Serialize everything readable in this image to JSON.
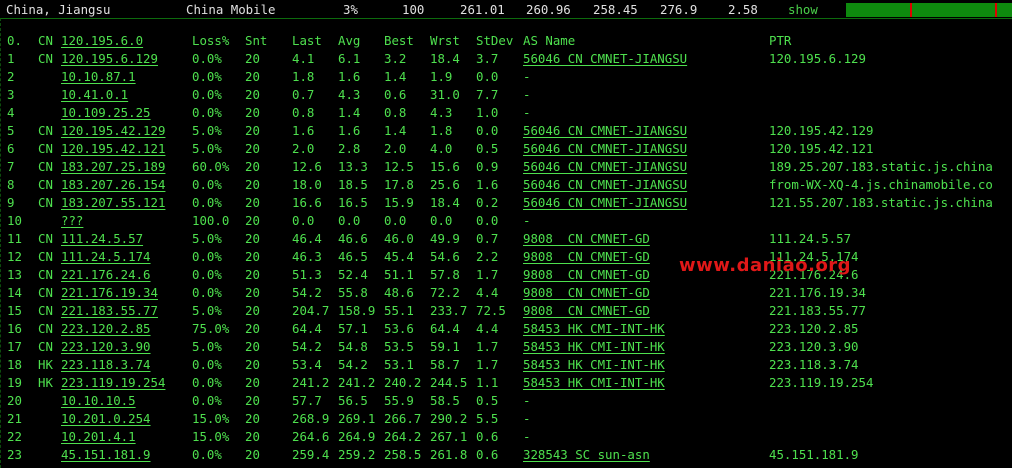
{
  "topbar": {
    "location": "China, Jiangsu",
    "isp": "China Mobile",
    "loss": "3%",
    "sent": "100",
    "last": "261.01",
    "avg": "260.96",
    "best": "258.45",
    "worst": "276.9",
    "stdev": "2.58",
    "show_label": "show"
  },
  "headers": {
    "num": "0.",
    "cc": "CN",
    "host": "120.195.6.0",
    "loss": "Loss%",
    "snt": "Snt",
    "last": "Last",
    "avg": "Avg",
    "best": "Best",
    "wrst": "Wrst",
    "stdev": "StDev",
    "asname": "AS Name",
    "ptr": "PTR"
  },
  "hops": [
    {
      "num": "1",
      "cc": "CN",
      "host": "120.195.6.129",
      "loss": "0.0%",
      "snt": "20",
      "last": "4.1",
      "avg": "6.1",
      "best": "3.2",
      "wrst": "18.4",
      "stdev": "3.7",
      "asname": "56046 CN CMNET-JIANGSU",
      "ptr": "120.195.6.129"
    },
    {
      "num": "2",
      "cc": "",
      "host": "10.10.87.1",
      "loss": "0.0%",
      "snt": "20",
      "last": "1.8",
      "avg": "1.6",
      "best": "1.4",
      "wrst": "1.9",
      "stdev": "0.0",
      "asname": "-",
      "ptr": ""
    },
    {
      "num": "3",
      "cc": "",
      "host": "10.41.0.1",
      "loss": "0.0%",
      "snt": "20",
      "last": "0.7",
      "avg": "4.3",
      "best": "0.6",
      "wrst": "31.0",
      "stdev": "7.7",
      "asname": "-",
      "ptr": ""
    },
    {
      "num": "4",
      "cc": "",
      "host": "10.109.25.25",
      "loss": "0.0%",
      "snt": "20",
      "last": "0.8",
      "avg": "1.4",
      "best": "0.8",
      "wrst": "4.3",
      "stdev": "1.0",
      "asname": "-",
      "ptr": ""
    },
    {
      "num": "5",
      "cc": "CN",
      "host": "120.195.42.129",
      "loss": "5.0%",
      "snt": "20",
      "last": "1.6",
      "avg": "1.6",
      "best": "1.4",
      "wrst": "1.8",
      "stdev": "0.0",
      "asname": "56046 CN CMNET-JIANGSU",
      "ptr": "120.195.42.129"
    },
    {
      "num": "6",
      "cc": "CN",
      "host": "120.195.42.121",
      "loss": "5.0%",
      "snt": "20",
      "last": "2.0",
      "avg": "2.8",
      "best": "2.0",
      "wrst": "4.0",
      "stdev": "0.5",
      "asname": "56046 CN CMNET-JIANGSU",
      "ptr": "120.195.42.121"
    },
    {
      "num": "7",
      "cc": "CN",
      "host": "183.207.25.189",
      "loss": "60.0%",
      "snt": "20",
      "last": "12.6",
      "avg": "13.3",
      "best": "12.5",
      "wrst": "15.6",
      "stdev": "0.9",
      "asname": "56046 CN CMNET-JIANGSU",
      "ptr": "189.25.207.183.static.js.china"
    },
    {
      "num": "8",
      "cc": "CN",
      "host": "183.207.26.154",
      "loss": "0.0%",
      "snt": "20",
      "last": "18.0",
      "avg": "18.5",
      "best": "17.8",
      "wrst": "25.6",
      "stdev": "1.6",
      "asname": "56046 CN CMNET-JIANGSU",
      "ptr": "from-WX-XQ-4.js.chinamobile.co"
    },
    {
      "num": "9",
      "cc": "CN",
      "host": "183.207.55.121",
      "loss": "0.0%",
      "snt": "20",
      "last": "16.6",
      "avg": "16.5",
      "best": "15.9",
      "wrst": "18.4",
      "stdev": "0.2",
      "asname": "56046 CN CMNET-JIANGSU",
      "ptr": "121.55.207.183.static.js.china"
    },
    {
      "num": "10",
      "cc": "",
      "host": "???",
      "loss": "100.0",
      "snt": "20",
      "last": "0.0",
      "avg": "0.0",
      "best": "0.0",
      "wrst": "0.0",
      "stdev": "0.0",
      "asname": "-",
      "ptr": ""
    },
    {
      "num": "11",
      "cc": "CN",
      "host": "111.24.5.57",
      "loss": "5.0%",
      "snt": "20",
      "last": "46.4",
      "avg": "46.6",
      "best": "46.0",
      "wrst": "49.9",
      "stdev": "0.7",
      "asname": "9808  CN CMNET-GD",
      "ptr": "111.24.5.57"
    },
    {
      "num": "12",
      "cc": "CN",
      "host": "111.24.5.174",
      "loss": "0.0%",
      "snt": "20",
      "last": "46.3",
      "avg": "46.5",
      "best": "45.4",
      "wrst": "54.6",
      "stdev": "2.2",
      "asname": "9808  CN CMNET-GD",
      "ptr": "111.24.5.174"
    },
    {
      "num": "13",
      "cc": "CN",
      "host": "221.176.24.6",
      "loss": "0.0%",
      "snt": "20",
      "last": "51.3",
      "avg": "52.4",
      "best": "51.1",
      "wrst": "57.8",
      "stdev": "1.7",
      "asname": "9808  CN CMNET-GD",
      "ptr": "221.176.24.6"
    },
    {
      "num": "14",
      "cc": "CN",
      "host": "221.176.19.34",
      "loss": "0.0%",
      "snt": "20",
      "last": "54.2",
      "avg": "55.8",
      "best": "48.6",
      "wrst": "72.2",
      "stdev": "4.4",
      "asname": "9808  CN CMNET-GD",
      "ptr": "221.176.19.34"
    },
    {
      "num": "15",
      "cc": "CN",
      "host": "221.183.55.77",
      "loss": "5.0%",
      "snt": "20",
      "last": "204.7",
      "avg": "158.9",
      "best": "55.1",
      "wrst": "233.7",
      "stdev": "72.5",
      "asname": "9808  CN CMNET-GD",
      "ptr": "221.183.55.77"
    },
    {
      "num": "16",
      "cc": "CN",
      "host": "223.120.2.85",
      "loss": "75.0%",
      "snt": "20",
      "last": "64.4",
      "avg": "57.1",
      "best": "53.6",
      "wrst": "64.4",
      "stdev": "4.4",
      "asname": "58453 HK CMI-INT-HK",
      "ptr": "223.120.2.85"
    },
    {
      "num": "17",
      "cc": "CN",
      "host": "223.120.3.90",
      "loss": "5.0%",
      "snt": "20",
      "last": "54.2",
      "avg": "54.8",
      "best": "53.5",
      "wrst": "59.1",
      "stdev": "1.7",
      "asname": "58453 HK CMI-INT-HK",
      "ptr": "223.120.3.90"
    },
    {
      "num": "18",
      "cc": "HK",
      "host": "223.118.3.74",
      "loss": "0.0%",
      "snt": "20",
      "last": "53.4",
      "avg": "54.2",
      "best": "53.1",
      "wrst": "58.7",
      "stdev": "1.7",
      "asname": "58453 HK CMI-INT-HK",
      "ptr": "223.118.3.74"
    },
    {
      "num": "19",
      "cc": "HK",
      "host": "223.119.19.254",
      "loss": "0.0%",
      "snt": "20",
      "last": "241.2",
      "avg": "241.2",
      "best": "240.2",
      "wrst": "244.5",
      "stdev": "1.1",
      "asname": "58453 HK CMI-INT-HK",
      "ptr": "223.119.19.254"
    },
    {
      "num": "20",
      "cc": "",
      "host": "10.10.10.5",
      "loss": "0.0%",
      "snt": "20",
      "last": "57.7",
      "avg": "56.5",
      "best": "55.9",
      "wrst": "58.5",
      "stdev": "0.5",
      "asname": "-",
      "ptr": ""
    },
    {
      "num": "21",
      "cc": "",
      "host": "10.201.0.254",
      "loss": "15.0%",
      "snt": "20",
      "last": "268.9",
      "avg": "269.1",
      "best": "266.7",
      "wrst": "290.2",
      "stdev": "5.5",
      "asname": "-",
      "ptr": ""
    },
    {
      "num": "22",
      "cc": "",
      "host": "10.201.4.1",
      "loss": "15.0%",
      "snt": "20",
      "last": "264.6",
      "avg": "264.9",
      "best": "264.2",
      "wrst": "267.1",
      "stdev": "0.6",
      "asname": "-",
      "ptr": ""
    },
    {
      "num": "23",
      "cc": "",
      "host": "45.151.181.9",
      "loss": "0.0%",
      "snt": "20",
      "last": "259.4",
      "avg": "259.2",
      "best": "258.5",
      "wrst": "261.8",
      "stdev": "0.6",
      "asname": "328543 SC sun-asn",
      "ptr": "45.151.181.9"
    }
  ],
  "watermark": "www.daniao.org",
  "colors": {
    "background": "#000000",
    "text": "#4ee04e",
    "topbar_text": "#e0e0e0",
    "bar_fill": "#0e8a0e",
    "bar_marker": "#e00000",
    "watermark": "#e01818"
  }
}
